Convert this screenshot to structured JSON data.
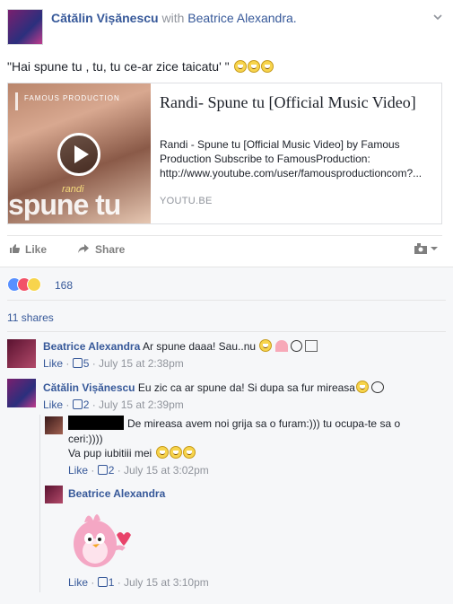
{
  "post": {
    "author": "Cătălin Vișănescu",
    "with_label": "with",
    "tagged": "Beatrice Alexandra.",
    "status_text": "\"Hai spune tu , tu, tu ce-ar zice taicatu' \"",
    "link": {
      "title": "Randi- Spune tu [Official Music Video]",
      "description": "Randi - Spune tu [Official Music Video] by Famous Production Subscribe to FamousProduction: http://www.youtube.com/user/famousproductioncom?...",
      "domain": "YOUTU.BE",
      "thumb_logo": "FAMOUS PRODUCTION",
      "thumb_small": "randi",
      "thumb_big": "spune tu"
    },
    "actions": {
      "like": "Like",
      "share": "Share"
    },
    "reactions_count": "168",
    "shares": "11 shares"
  },
  "comments": [
    {
      "author": "Beatrice Alexandra",
      "text": "Ar spune daaa! Sau..nu",
      "like_label": "Like",
      "likes": "5",
      "time": "July 15 at 2:38pm"
    },
    {
      "author": "Cătălin Vișănescu",
      "text": "Eu zic ca ar spune da! Si dupa sa fur mireasa",
      "like_label": "Like",
      "likes": "2",
      "time": "July 15 at 2:39pm"
    }
  ],
  "replies": [
    {
      "text_line1": "De mireasa avem noi grija sa o furam:))) tu ocupa-te sa o",
      "text_line2": "ceri:))))",
      "text_line3": "Va pup iubitiii mei",
      "like_label": "Like",
      "likes": "2",
      "time": "July 15 at 3:02pm"
    },
    {
      "author": "Beatrice Alexandra",
      "like_label": "Like",
      "likes": "1",
      "time": "July 15 at 3:10pm"
    }
  ],
  "colors": {
    "link": "#365899",
    "meta": "#90949c",
    "footer_bg": "#f6f7f9"
  },
  "icons": [
    "chevron-down-icon",
    "play-icon",
    "like-icon",
    "share-icon",
    "audience-icon",
    "reaction-like-icon",
    "reaction-love-icon",
    "reaction-haha-icon",
    "thumb-up-icon",
    "sticker-bird"
  ]
}
